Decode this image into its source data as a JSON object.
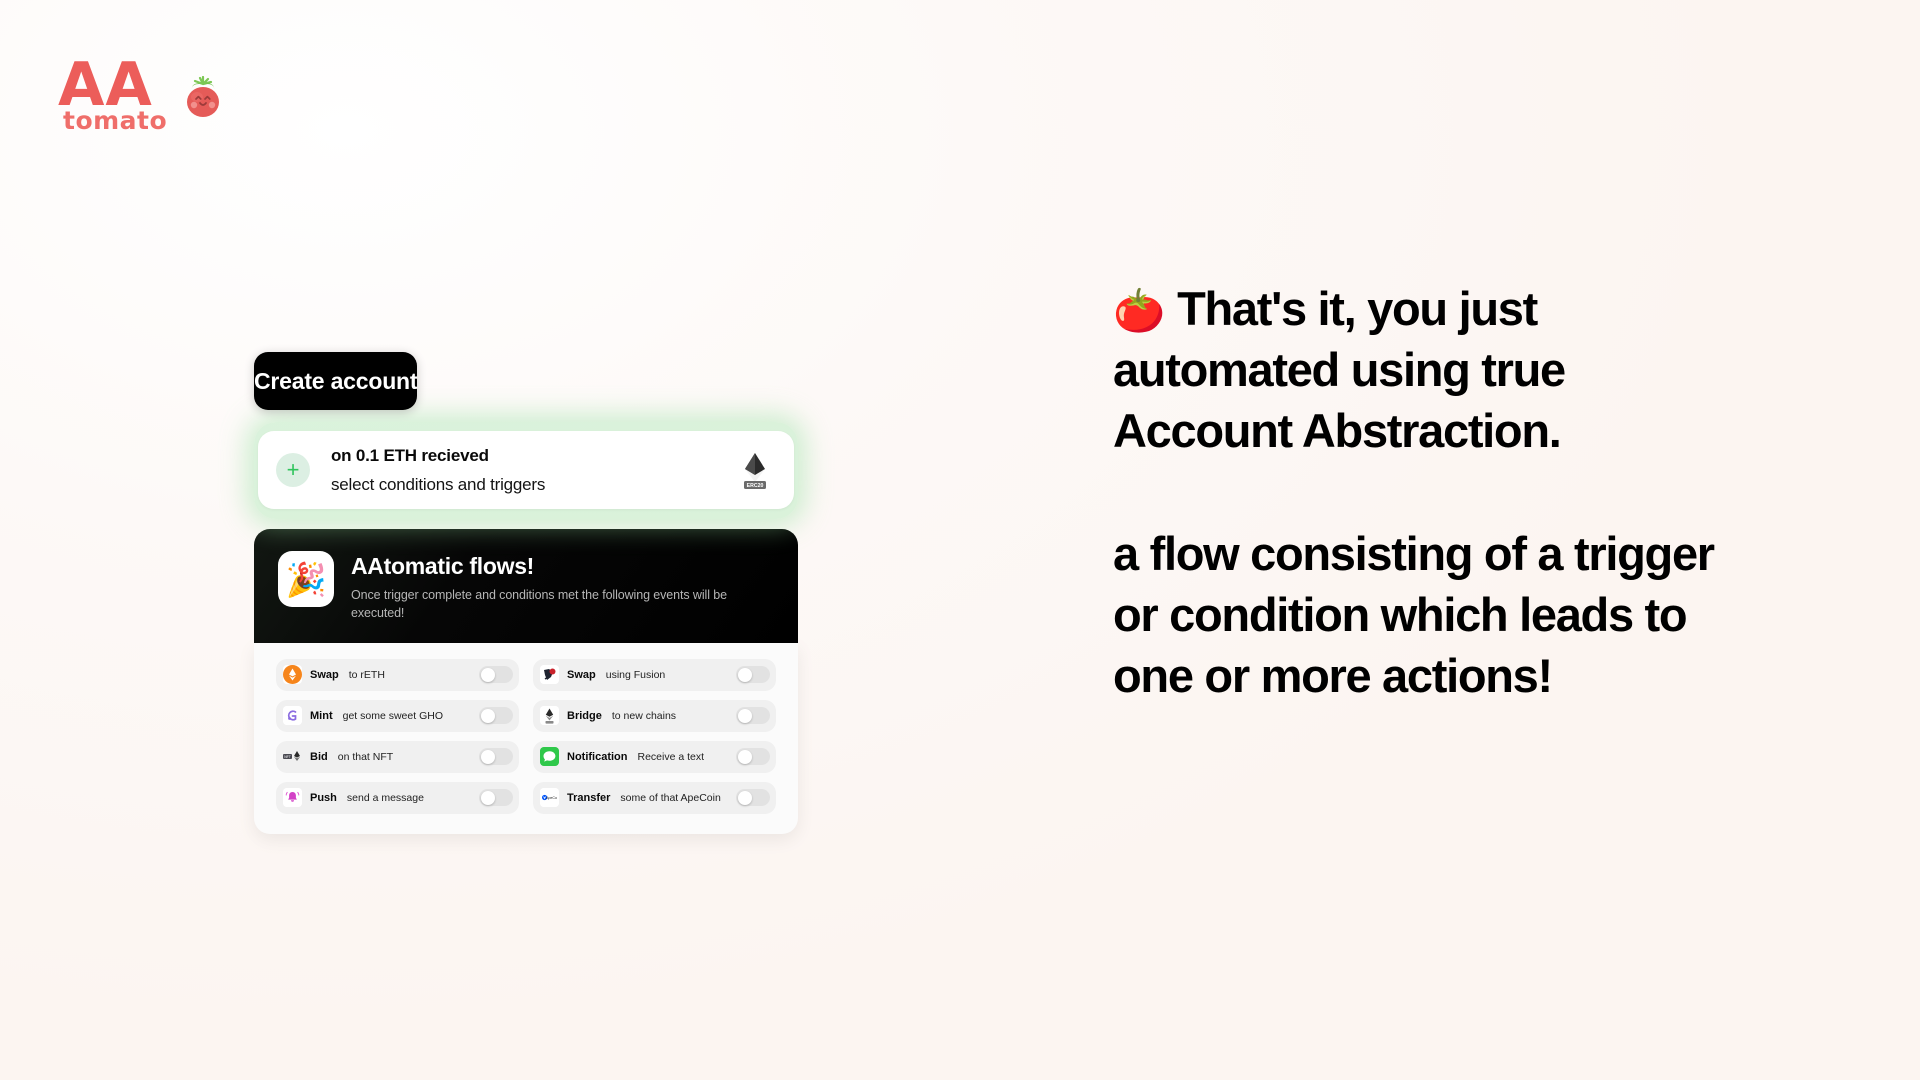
{
  "brand": {
    "wordmark": "AA",
    "subword": "tomato",
    "mascot_icon": "tomato-mascot-icon",
    "primary_color": "#ec5d5a"
  },
  "flow": {
    "create_account_label": "Create account",
    "trigger": {
      "add_icon": "plus-icon",
      "title": "on 0.1 ETH recieved",
      "subtitle": "select conditions and triggers",
      "token_icon": "ethereum-erc20-icon",
      "token_badge_label": "ERC20",
      "glow_color": "#96e1a0"
    },
    "flows_header": {
      "emoji": "🎉",
      "emoji_icon": "party-popper-icon",
      "title": "AAtomatic flows!",
      "subtitle": "Once trigger complete and conditions met the following events will be executed!"
    },
    "actions": [
      {
        "icon": "ethereum-orange-icon",
        "emoji": "",
        "label": "Swap",
        "desc": "to rETH",
        "enabled": false,
        "col": "left"
      },
      {
        "icon": "gho-mint-icon",
        "emoji": "",
        "label": "Mint",
        "desc": "get some sweet GHO",
        "enabled": false,
        "col": "left"
      },
      {
        "icon": "nft-bid-icon",
        "emoji": "",
        "label": "Bid",
        "desc": "on that NFT",
        "enabled": false,
        "col": "left"
      },
      {
        "icon": "push-bell-icon",
        "emoji": "🔔",
        "label": "Push",
        "desc": "send a message",
        "enabled": false,
        "col": "left"
      },
      {
        "icon": "1inch-fusion-icon",
        "emoji": "",
        "label": "Swap",
        "desc": "using Fusion",
        "enabled": false,
        "col": "right"
      },
      {
        "icon": "ethereum-bridge-icon",
        "emoji": "",
        "label": "Bridge",
        "desc": "to new chains",
        "enabled": false,
        "col": "right"
      },
      {
        "icon": "message-notification-icon",
        "emoji": "",
        "label": "Notification",
        "desc": "Receive a text",
        "enabled": false,
        "col": "right"
      },
      {
        "icon": "apecoin-transfer-icon",
        "emoji": "",
        "label": "Transfer",
        "desc": "some of that ApeCoin",
        "enabled": false,
        "col": "right"
      }
    ]
  },
  "copy": {
    "emoji": "🍅",
    "paragraph_1": "That's it, you just automated using true Account Abstraction.",
    "paragraph_2": "a flow consisting of a trigger or condition which leads to one or more actions!"
  }
}
